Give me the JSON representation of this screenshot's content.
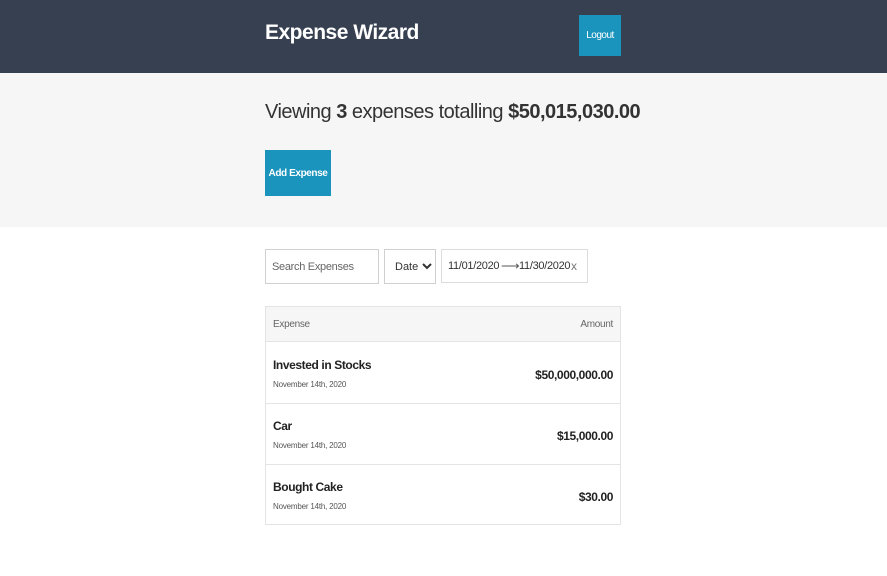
{
  "header": {
    "title": "Expense Wizard",
    "logout_label": "Logout"
  },
  "summary": {
    "prefix": "Viewing ",
    "count": "3",
    "middle": " expenses totalling ",
    "total": "$50,015,030.00",
    "add_label": "Add Expense"
  },
  "filters": {
    "search_placeholder": "Search Expenses",
    "sort_selected": "Date",
    "start_date": "11/01/2020",
    "end_date": "11/30/2020",
    "clear_label": "x"
  },
  "table": {
    "col_expense": "Expense",
    "col_amount": "Amount",
    "rows": [
      {
        "description": "Invested in Stocks",
        "date": "November 14th, 2020",
        "amount": "$50,000,000.00"
      },
      {
        "description": "Car",
        "date": "November 14th, 2020",
        "amount": "$15,000.00"
      },
      {
        "description": "Bought Cake",
        "date": "November 14th, 2020",
        "amount": "$30.00"
      }
    ]
  },
  "colors": {
    "header_bg": "#364051",
    "accent": "#1a94bd",
    "summary_bg": "#f6f6f6"
  },
  "icons": {
    "arrow": "arrow-right-icon",
    "clear": "close-icon"
  }
}
